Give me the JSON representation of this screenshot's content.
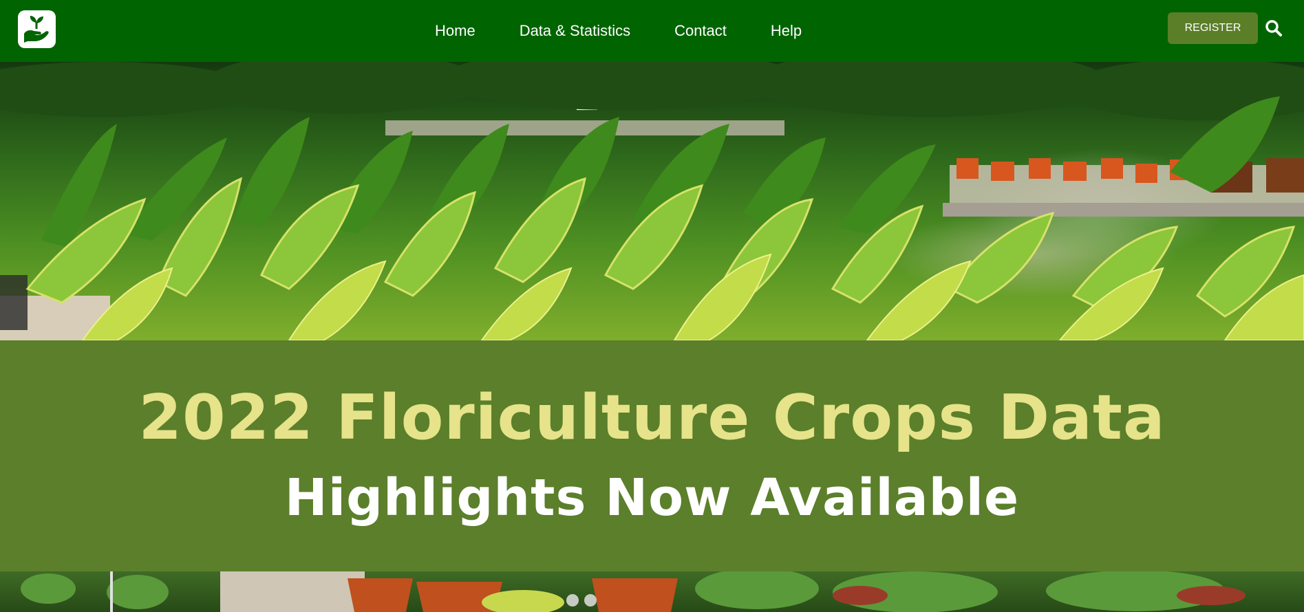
{
  "header": {
    "logo": {
      "icon": "hand-holding-sprout-icon"
    },
    "nav": [
      {
        "label": "Home"
      },
      {
        "label": "Data & Statistics"
      },
      {
        "label": "Contact"
      },
      {
        "label": "Help"
      }
    ],
    "register_label": "REGISTER",
    "search_icon": "search-icon"
  },
  "banner": {
    "year": "2022",
    "title": "Floriculture Crops Data",
    "subtitle": "Highlights Now Available"
  },
  "carousel": {
    "slide_count": 2,
    "active_index": 0
  },
  "colors": {
    "nav_background": "#006400",
    "register_button": "#5b7f29",
    "banner_background": "#5b7f2b",
    "banner_title": "#e6e38a",
    "banner_subtitle": "#ffffff"
  }
}
